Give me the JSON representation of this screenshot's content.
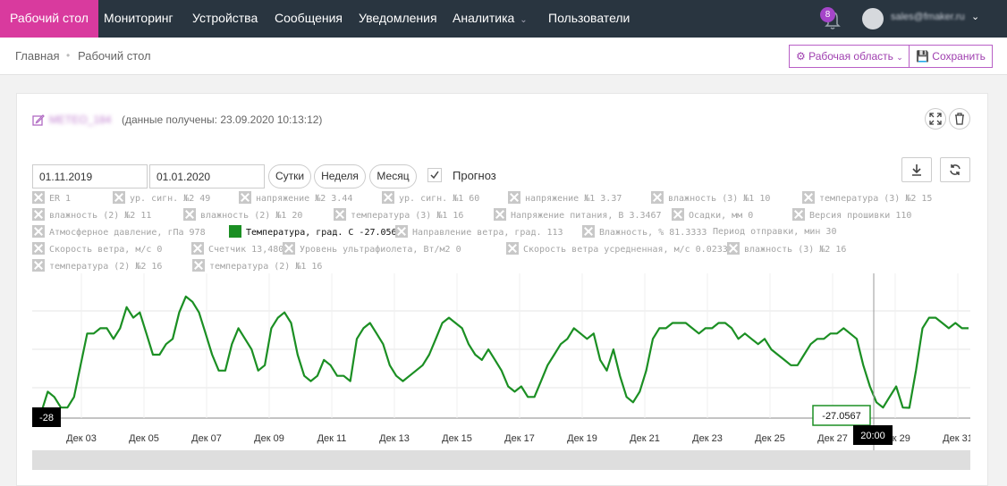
{
  "nav": {
    "items": [
      "Рабочий стол",
      "Мониторинг",
      "Устройства",
      "Сообщения",
      "Уведомления",
      "Аналитика",
      "Пользователи"
    ],
    "bell_count": "8",
    "username": "sales@fmaker.ru"
  },
  "breadcrumb": {
    "home": "Главная",
    "current": "Рабочий стол"
  },
  "toolbar": {
    "workspace": "Рабочая область",
    "save": "Сохранить"
  },
  "widget": {
    "device_name": "METEO_184",
    "data_received": "(данные получены: 23.09.2020 10:13:12)",
    "date_from": "01.11.2019",
    "date_to": "01.01.2020",
    "periods": [
      "Сутки",
      "Неделя",
      "Месяц"
    ],
    "forecast_label": "Прогноз",
    "legend": [
      "ER 1",
      "ур. сигн. №2 49",
      "напряжение №2 3.44",
      "ур. сигн. №1 60",
      "напряжение №1 3.37",
      "влажность (3) №1 10",
      "температура (3) №2 15",
      "влажность (2) №2 11",
      "влажность (2) №1 20",
      "температура (3) №1 16",
      "Напряжение питания, В 3.3467",
      "Осадки, мм 0",
      "Версия прошивки 110",
      "Атмосферное давление, гПа 978",
      "Температура, град. С -27.0567",
      "Направление ветра, град. 113",
      "Влажность, % 81.3333",
      "Период отправки, мин 30",
      "Скорость ветра, м/с 0",
      "Счетчик 13,480",
      "Уровень ультрафиолета, Вт/м2 0",
      "Скорость ветра усредненная, м/с 0.0233",
      "влажность (3) №2 16",
      "температура (2) №2 16",
      "температура (2) №1 16"
    ],
    "active_series_color": "#1b8f23"
  },
  "chart_data": {
    "type": "line",
    "series": [
      {
        "name": "Температура, град. С",
        "values": [
          -28,
          -24,
          -25,
          -27,
          -27,
          -25,
          -19,
          -13,
          -13,
          -12,
          -12,
          -14,
          -12,
          -8,
          -10,
          -9,
          -13,
          -17,
          -17,
          -15,
          -14,
          -9,
          -6,
          -7,
          -9,
          -13,
          -17,
          -20,
          -20,
          -15,
          -12,
          -14,
          -16,
          -20,
          -19,
          -12,
          -10,
          -9,
          -11,
          -17,
          -21,
          -22,
          -21,
          -18,
          -19,
          -21,
          -21,
          -22,
          -14,
          -12,
          -11,
          -13,
          -15,
          -19,
          -21,
          -22,
          -21,
          -20,
          -19,
          -17,
          -14,
          -11,
          -10,
          -11,
          -12,
          -15,
          -17,
          -18,
          -16,
          -18,
          -20,
          -23,
          -24,
          -23,
          -25,
          -25,
          -22,
          -19,
          -17,
          -15,
          -14,
          -12,
          -13,
          -14,
          -13,
          -18,
          -20,
          -16,
          -21,
          -25,
          -26,
          -24,
          -20,
          -14,
          -12,
          -12,
          -11,
          -11,
          -11,
          -12,
          -13,
          -12,
          -12,
          -11,
          -11,
          -12,
          -14,
          -13,
          -14,
          -15,
          -14,
          -16,
          -17,
          -18,
          -19,
          -19,
          -17,
          -15,
          -14,
          -14,
          -13,
          -13,
          -12,
          -13,
          -14,
          -19,
          -23,
          -26,
          -27,
          -25,
          -23,
          -27,
          -27.0567,
          -20,
          -12,
          -10,
          -10,
          -11,
          -12,
          -11,
          -12,
          -12
        ],
        "color": "#1b8f23"
      }
    ],
    "x_ticks": [
      "Дек 03",
      "Дек 05",
      "Дек 07",
      "Дек 09",
      "Дек 11",
      "Дек 13",
      "Дек 15",
      "Дек 17",
      "Дек 19",
      "Дек 21",
      "Дек 23",
      "Дек 25",
      "Дек 27",
      "Дек 29",
      "Дек 31"
    ],
    "y_min_label": "-28",
    "tooltip_value": "-27.0567",
    "crosshair_time": "20:00",
    "ylim": [
      -29,
      -5
    ]
  }
}
